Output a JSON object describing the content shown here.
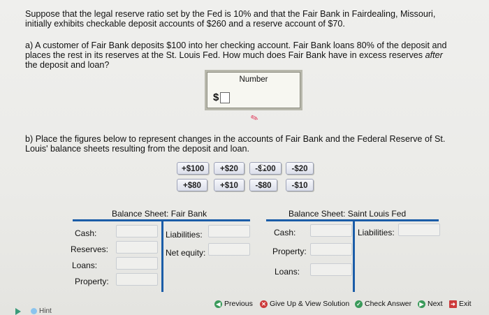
{
  "question": {
    "intro": "Suppose that the legal reserve ratio set by the Fed is 10% and that the Fair Bank in Fairdealing, Missouri, initially exhibits checkable deposit accounts of $260 and a reserve account of $70.",
    "part_a": "a) A customer of Fair Bank deposits $100 into her checking account. Fair Bank loans 80% of the deposit and places the rest in its reserves at the St. Louis Fed. How much does Fair Bank have in excess reserves",
    "part_a_italic": "after",
    "part_a_end": "the deposit and loan?",
    "part_b": "b) Place the figures below to represent changes in the accounts of Fair Bank and the Federal Reserve of St. Louis' balance sheets resulting from the deposit and loan."
  },
  "number_box": {
    "label": "Number",
    "currency": "$",
    "value": ""
  },
  "chips": [
    "+$100",
    "+$20",
    "-$100",
    "-$20",
    "+$80",
    "+$10",
    "-$80",
    "-$10"
  ],
  "sheets": {
    "fair_bank": {
      "title": "Balance Sheet: Fair Bank",
      "assets": [
        "Cash:",
        "Reserves:",
        "Loans:",
        "Property:"
      ],
      "liabilities": [
        "Liabilities:",
        "Net equity:"
      ]
    },
    "stl_fed": {
      "title": "Balance Sheet: Saint Louis Fed",
      "assets": [
        "Cash:",
        "Property:",
        "Loans:"
      ],
      "liabilities": [
        "Liabilities:"
      ]
    }
  },
  "nav": {
    "previous": "Previous",
    "give_up": "Give Up & View Solution",
    "check": "Check Answer",
    "next": "Next",
    "exit": "Exit"
  },
  "hint": "Hint",
  "colors": {
    "accent": "#1b5da8",
    "chip_border": "#9ea3b8",
    "hint_arrow": "#3a9a7a"
  }
}
